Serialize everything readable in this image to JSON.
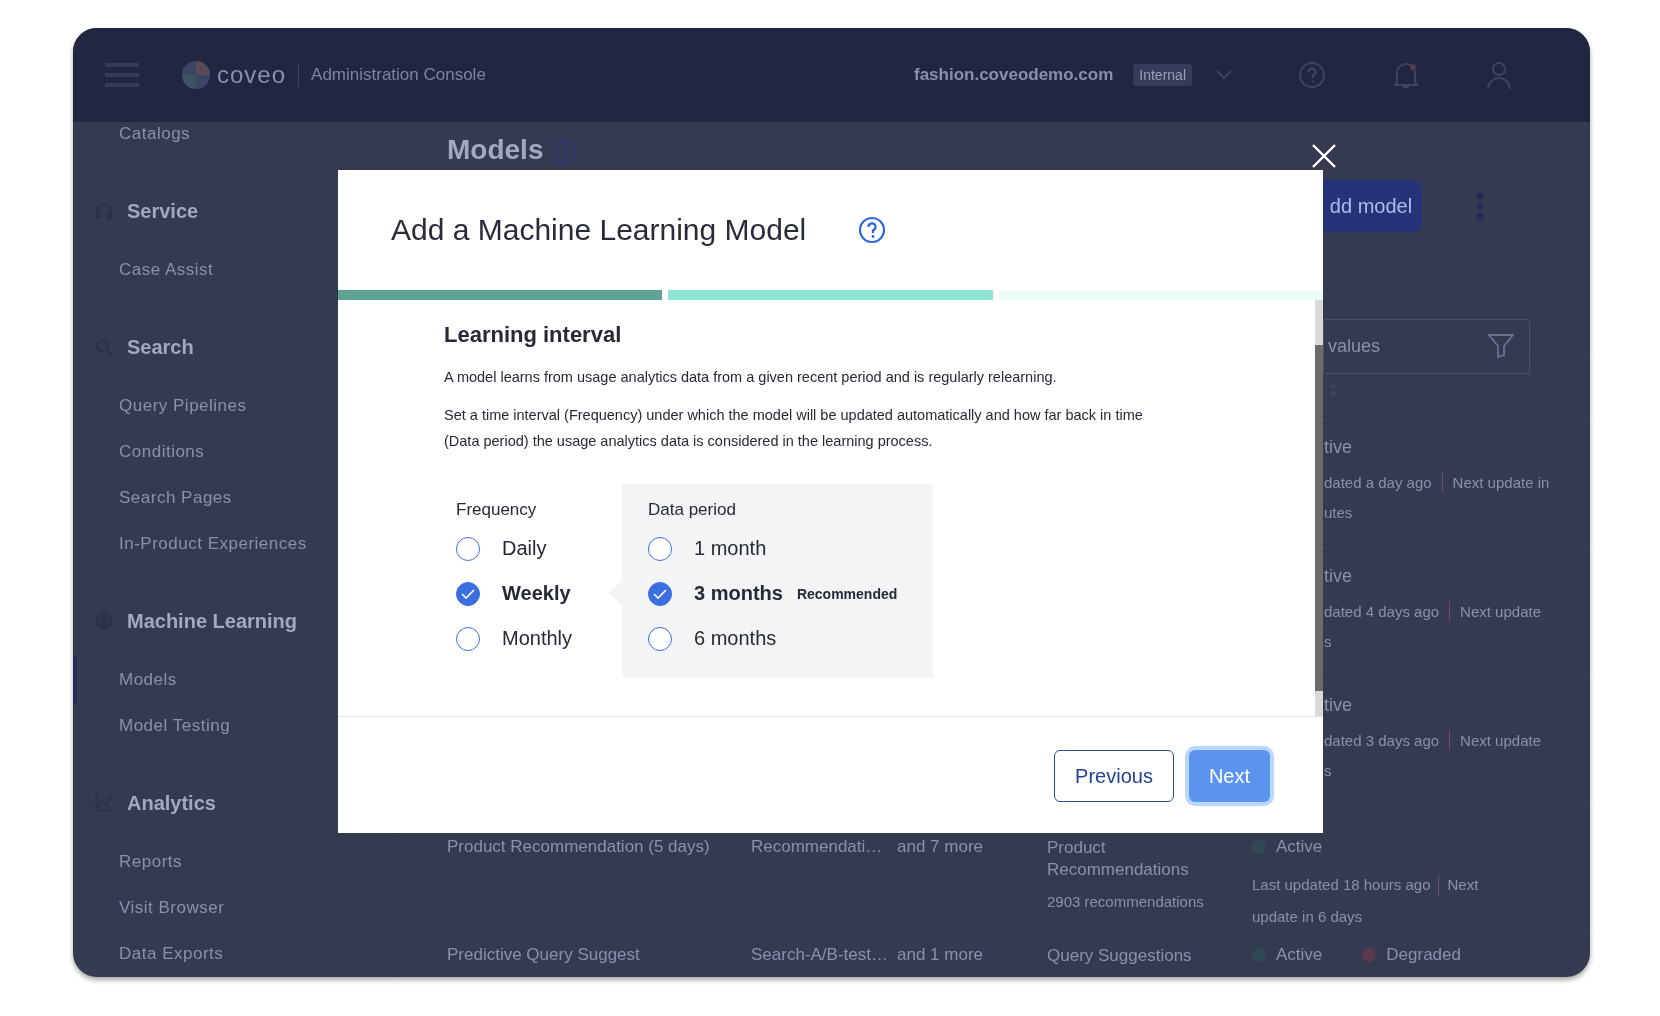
{
  "topbar": {
    "brand": "coveo",
    "console_title": "Administration Console",
    "organization": "fashion.coveodemo.com",
    "org_badge": "Internal"
  },
  "sidebar": {
    "items": [
      {
        "label": "Catalogs",
        "selected": false
      }
    ],
    "sections": [
      {
        "title": "Service",
        "kind": "headset",
        "items": [
          {
            "label": "Case Assist",
            "selected": false
          }
        ]
      },
      {
        "title": "Search",
        "kind": "search",
        "items": [
          {
            "label": "Query Pipelines",
            "selected": false
          },
          {
            "label": "Conditions",
            "selected": false
          },
          {
            "label": "Search Pages",
            "selected": false
          },
          {
            "label": "In-Product Experiences",
            "selected": false
          }
        ]
      },
      {
        "title": "Machine Learning",
        "kind": "ml",
        "items": [
          {
            "label": "Models",
            "selected": true
          },
          {
            "label": "Model Testing",
            "selected": false
          }
        ]
      },
      {
        "title": "Analytics",
        "kind": "chart",
        "items": [
          {
            "label": "Reports",
            "selected": false
          },
          {
            "label": "Visit Browser",
            "selected": false
          },
          {
            "label": "Data Exports",
            "selected": false
          }
        ]
      }
    ]
  },
  "page": {
    "title": "Models",
    "add_button": "dd model",
    "filter": {
      "placeholder": "values"
    },
    "partial_rows": [
      {
        "status": "tive",
        "updated": "dated a day ago",
        "next": "Next update in",
        "next_more": "utes"
      },
      {
        "status": "tive",
        "updated": "dated 4 days ago",
        "next": "Next update",
        "next_more": "s"
      },
      {
        "status": "tive",
        "updated": "dated 3 days ago",
        "next": "Next update",
        "next_more": "s"
      }
    ],
    "rows": [
      {
        "name": "Product Recommendation (5 days)",
        "tags": "Recommendati…",
        "more_tags": "and 7 more",
        "type": "Product Recommendations",
        "type_detail": "2903 recommendations",
        "statuses": [
          {
            "label": "Active",
            "color": "#2f4a55"
          }
        ],
        "updated": "Last updated 18 hours ago",
        "next": "Next update in 6 days"
      },
      {
        "name": "Predictive Query Suggest",
        "tags": "Search-A/B-test…",
        "more_tags": "and 1 more",
        "type": "Query Suggestions",
        "statuses": [
          {
            "label": "Active",
            "color": "#2f4a55"
          },
          {
            "label": "Degraded",
            "color": "#5a3a4c"
          }
        ]
      }
    ]
  },
  "modal": {
    "title": "Add a Machine Learning Model",
    "steps": [
      {
        "done": true,
        "current": false
      },
      {
        "done": false,
        "current": true
      },
      {
        "done": false,
        "current": false
      }
    ],
    "section_title": "Learning interval",
    "paragraphs": [
      "A model learns from usage analytics data from a given recent period and is regularly relearning.",
      "Set a time interval (Frequency) under which the model will be updated automatically and how far back in time (Data period) the usage analytics data is considered in the learning process."
    ],
    "frequency": {
      "label": "Frequency",
      "options": [
        {
          "label": "Daily",
          "selected": false
        },
        {
          "label": "Weekly",
          "selected": true
        },
        {
          "label": "Monthly",
          "selected": false
        }
      ]
    },
    "data_period": {
      "label": "Data period",
      "options": [
        {
          "label": "1 month",
          "selected": false
        },
        {
          "label": "3 months",
          "selected": true,
          "badge": "Recommended"
        },
        {
          "label": "6 months",
          "selected": false
        }
      ]
    },
    "buttons": {
      "previous": "Previous",
      "next": "Next"
    }
  }
}
